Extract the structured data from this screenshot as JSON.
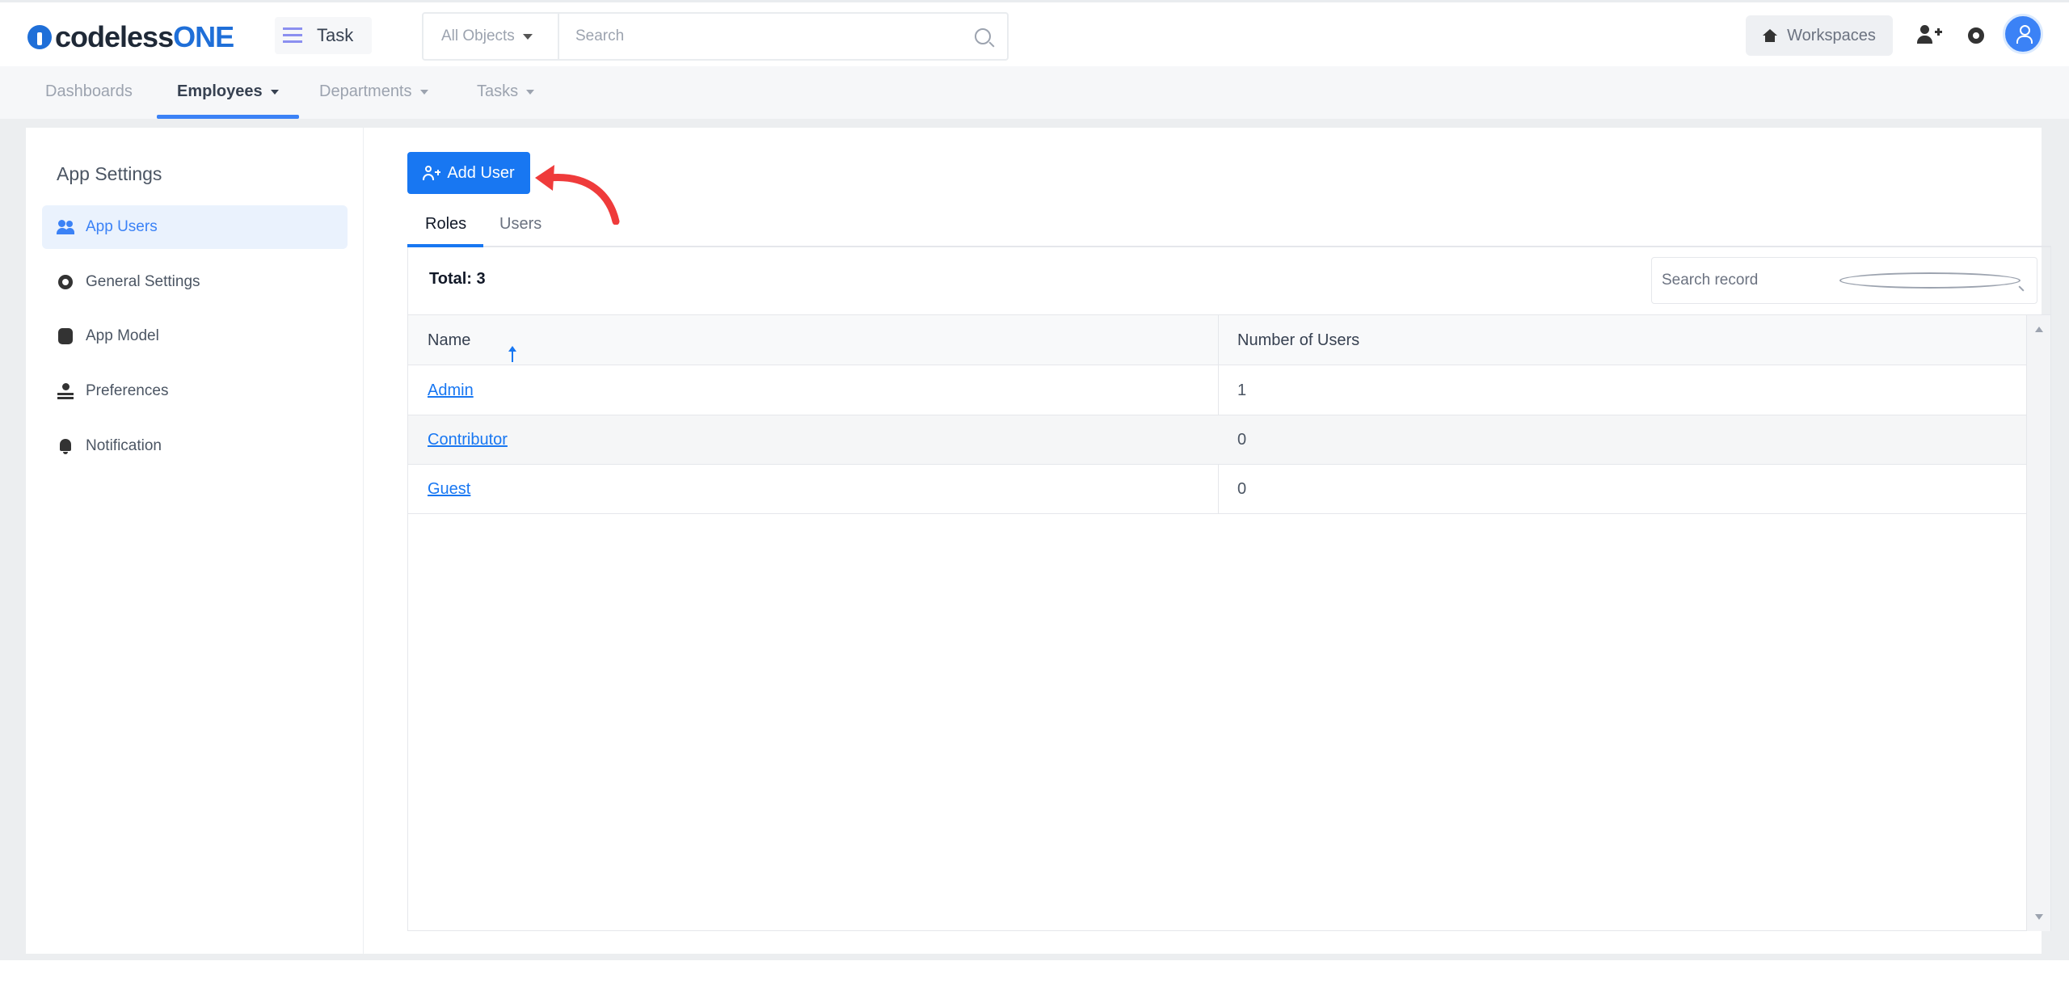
{
  "header": {
    "logo_main": "codeless",
    "logo_accent": "ONE",
    "app_name": "Task",
    "object_filter": "All Objects",
    "search_placeholder": "Search",
    "workspaces_label": "Workspaces"
  },
  "nav": {
    "items": [
      {
        "label": "Dashboards",
        "has_menu": false,
        "active": false
      },
      {
        "label": "Employees",
        "has_menu": true,
        "active": true
      },
      {
        "label": "Departments",
        "has_menu": true,
        "active": false
      },
      {
        "label": "Tasks",
        "has_menu": true,
        "active": false
      }
    ]
  },
  "sidebar": {
    "title": "App Settings",
    "items": [
      {
        "label": "App Users",
        "icon": "users-icon",
        "active": true
      },
      {
        "label": "General Settings",
        "icon": "gear-icon",
        "active": false
      },
      {
        "label": "App Model",
        "icon": "model-icon",
        "active": false
      },
      {
        "label": "Preferences",
        "icon": "preferences-icon",
        "active": false
      },
      {
        "label": "Notification",
        "icon": "bell-icon",
        "active": false
      }
    ]
  },
  "main": {
    "add_user_label": "Add User",
    "tabs": [
      {
        "label": "Roles",
        "active": true
      },
      {
        "label": "Users",
        "active": false
      }
    ],
    "total_label": "Total: 3",
    "record_search_placeholder": "Search record",
    "columns": [
      "Name",
      "Number of Users"
    ],
    "sort": {
      "column": "Name",
      "direction": "ascending"
    },
    "rows": [
      {
        "name": "Admin",
        "users": "1"
      },
      {
        "name": "Contributor",
        "users": "0"
      },
      {
        "name": "Guest",
        "users": "0"
      }
    ]
  },
  "colors": {
    "accent": "#1877f2",
    "annotation_arrow": "#ef3b3b",
    "active_sidebar_bg": "#eaf2fd"
  }
}
